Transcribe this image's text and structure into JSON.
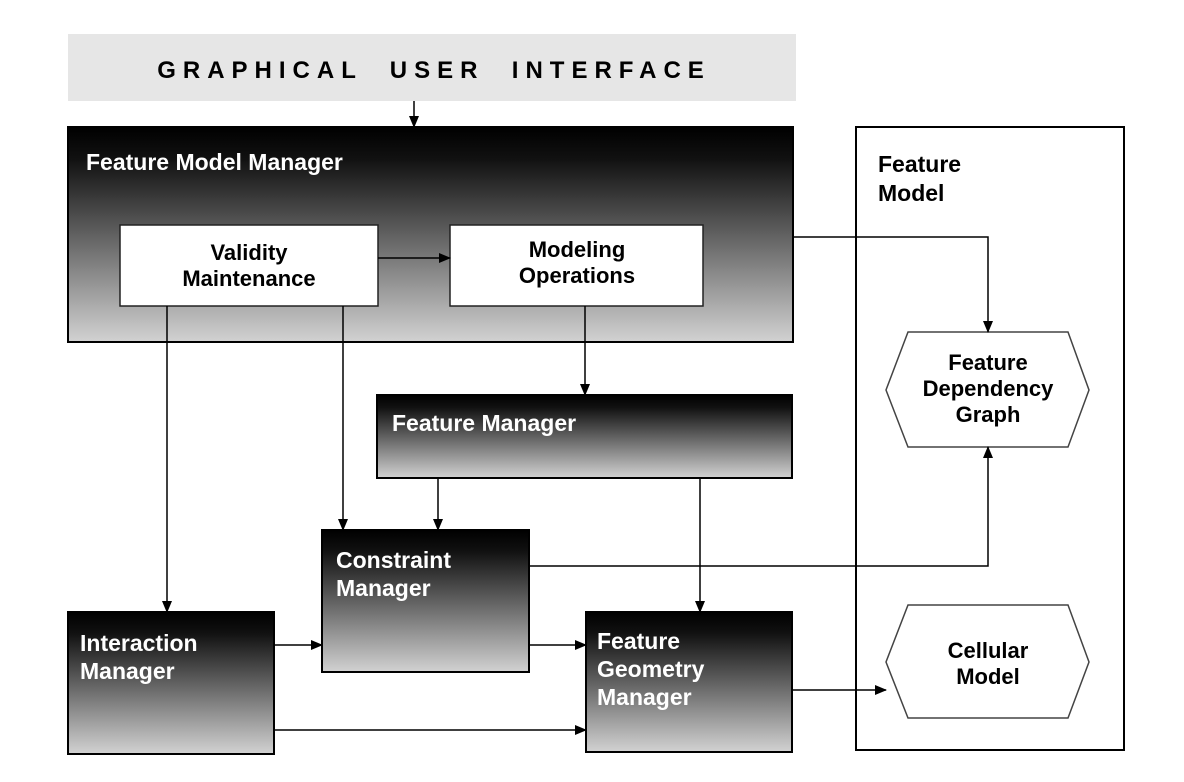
{
  "gui": {
    "label": "GRAPHICAL  USER  INTERFACE"
  },
  "feature_model_manager": {
    "title": "Feature Model Manager",
    "validity": [
      "Validity",
      "Maintenance"
    ],
    "modeling": [
      "Modeling",
      "Operations"
    ]
  },
  "feature_manager": {
    "title": "Feature Manager"
  },
  "constraint_manager": {
    "title": [
      "Constraint",
      "Manager"
    ]
  },
  "interaction_manager": {
    "title": [
      "Interaction",
      "Manager"
    ]
  },
  "feature_geometry_manager": {
    "title": [
      "Feature",
      "Geometry",
      "Manager"
    ]
  },
  "feature_model": {
    "title": [
      "Feature",
      "Model"
    ],
    "dependency_graph": [
      "Feature",
      "Dependency",
      "Graph"
    ],
    "cellular_model": [
      "Cellular",
      "Model"
    ]
  },
  "colors": {
    "gui_bar": "#e6e6e6",
    "gradient_top": "#000000",
    "gradient_bottom": "#d0d0d0"
  }
}
